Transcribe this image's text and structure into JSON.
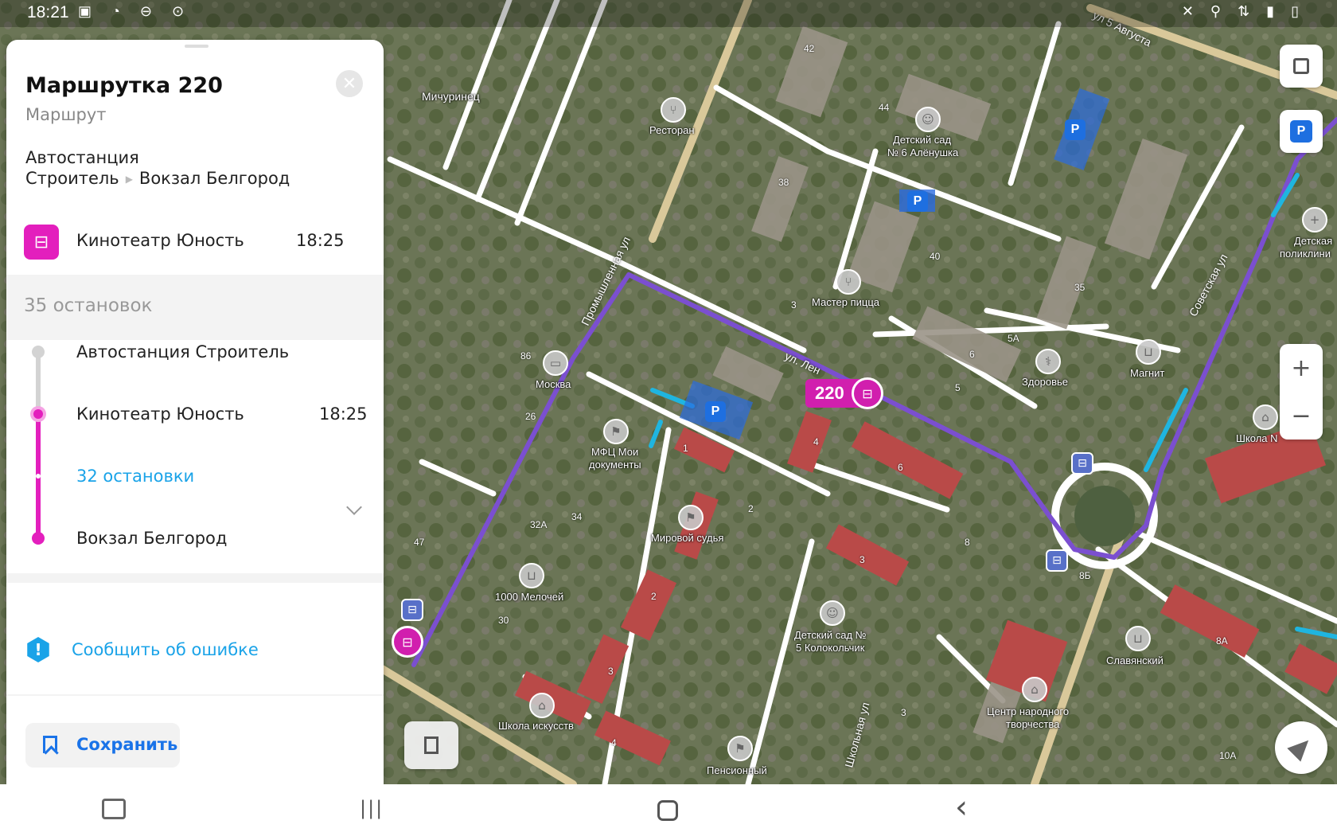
{
  "status_bar": {
    "time": "18:21"
  },
  "panel": {
    "title": "Маршрутка 220",
    "subtitle": "Маршрут",
    "route_from_line1": "Автостанция",
    "route_from_line2": "Строитель",
    "route_to": "Вокзал Белгород",
    "next_stop": {
      "name": "Кинотеатр Юность",
      "time": "18:25",
      "icon": "bus-icon"
    },
    "stops_count": "35 остановок",
    "timeline": [
      {
        "name": "Автостанция Строитель"
      },
      {
        "name": "Кинотеатр Юность",
        "time": "18:25"
      },
      {
        "name": "32 остановки",
        "expandable": true
      },
      {
        "name": "Вокзал Белгород"
      }
    ],
    "report_error": "Сообщить об ошибке",
    "save": "Сохранить",
    "accent_color": "#e31fbd",
    "link_color": "#1aa3e8"
  },
  "map": {
    "route_number": "220",
    "streets": [
      "ул 5 Августа",
      "Промышленная ул",
      "ул. Лен",
      "Советская ул",
      "Школьная ул"
    ],
    "pois": {
      "michurinets": "Мичуринец",
      "restaurant": "Ресторан",
      "kindergarten6_l1": "Детский сад",
      "kindergarten6_l2": "№ 6 Алёнушка",
      "master_pizza": "Мастер пицца",
      "moskva": "Москва",
      "mfc_l1": "МФЦ Мои",
      "mfc_l2": "документы",
      "mirovoy": "Мировой судья",
      "zdorovye": "Здоровье",
      "magnit": "Магнит",
      "school": "Школа N",
      "children_poly_l1": "Детская",
      "children_poly_l2": "поликлини",
      "melochey": "1000 Мелочей",
      "kindergarten5_l1": "Детский сад №",
      "kindergarten5_l2": "5 Колокольчик",
      "slavyanskiy": "Славянский",
      "center_l1": "Центр народного",
      "center_l2": "творчества",
      "art_school": "Школа искусств",
      "pension": "Пенсионный"
    },
    "house_numbers": [
      "42",
      "44",
      "38",
      "40",
      "35",
      "5А",
      "5",
      "3",
      "6",
      "4",
      "1",
      "2",
      "3",
      "8",
      "8Б",
      "86",
      "26",
      "32А",
      "34",
      "47",
      "30",
      "2",
      "3",
      "4",
      "6",
      "8А",
      "10А",
      "3"
    ]
  },
  "nav_bar": {
    "recent": "|||",
    "home": "○",
    "back": "‹"
  }
}
